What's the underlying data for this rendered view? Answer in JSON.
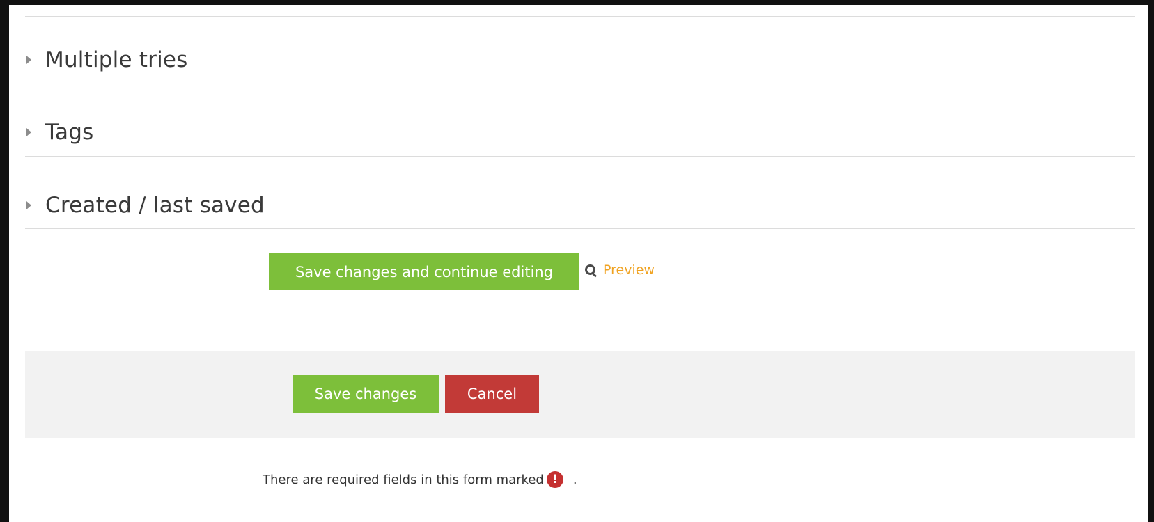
{
  "sections": [
    {
      "title": "Multiple tries"
    },
    {
      "title": "Tags"
    },
    {
      "title": "Created / last saved"
    }
  ],
  "actions": {
    "save_continue_label": "Save changes and continue editing",
    "preview_label": "Preview"
  },
  "footer": {
    "save_label": "Save changes",
    "cancel_label": "Cancel",
    "required_note": "There are required fields in this form marked",
    "required_icon_glyph": "!",
    "required_note_suffix": "."
  },
  "colors": {
    "primary_green": "#7dbf3a",
    "danger_red": "#c23a37",
    "link_orange": "#f0a220",
    "required_icon": "#c53030"
  },
  "icons": {
    "section_toggle": "caret-right-icon",
    "preview": "search-icon",
    "required": "exclamation-circle-icon"
  }
}
